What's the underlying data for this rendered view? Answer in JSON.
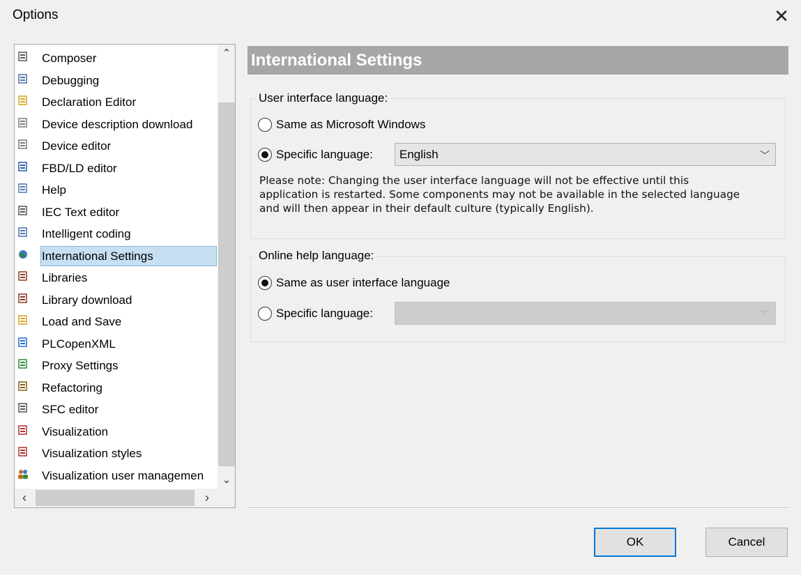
{
  "window": {
    "title": "Options",
    "close_icon": "close-icon"
  },
  "tree": {
    "items": [
      {
        "label": "Composer",
        "icon": "composer-icon",
        "color": "#5a5a5a"
      },
      {
        "label": "Debugging",
        "icon": "debugging-icon",
        "color": "#4a6fa5"
      },
      {
        "label": "Declaration Editor",
        "icon": "declaration-editor-icon",
        "color": "#d4a21a"
      },
      {
        "label": "Device description download",
        "icon": "device-download-icon",
        "color": "#7a7a7a"
      },
      {
        "label": "Device editor",
        "icon": "device-editor-icon",
        "color": "#7a7a7a"
      },
      {
        "label": "FBD/LD editor",
        "icon": "fbd-ld-icon",
        "color": "#2a58a8"
      },
      {
        "label": "Help",
        "icon": "help-book-icon",
        "color": "#4a7ab5"
      },
      {
        "label": "IEC Text editor",
        "icon": "iec-text-icon",
        "color": "#555555"
      },
      {
        "label": "Intelligent coding",
        "icon": "intelligent-coding-icon",
        "color": "#4a6fa5"
      },
      {
        "label": "International Settings",
        "icon": "globe-icon",
        "color": "#2f8a3a",
        "selected": true
      },
      {
        "label": "Libraries",
        "icon": "libraries-icon",
        "color": "#8a3a1a"
      },
      {
        "label": "Library download",
        "icon": "library-download-icon",
        "color": "#8a3a1a"
      },
      {
        "label": "Load and Save",
        "icon": "folder-icon",
        "color": "#d4a21a"
      },
      {
        "label": "PLCopenXML",
        "icon": "plcopenxml-icon",
        "color": "#1e6fd1"
      },
      {
        "label": "Proxy Settings",
        "icon": "proxy-icon",
        "color": "#2f8a3a"
      },
      {
        "label": "Refactoring",
        "icon": "refactoring-icon",
        "color": "#8a5a1a"
      },
      {
        "label": "SFC editor",
        "icon": "sfc-editor-icon",
        "color": "#555555"
      },
      {
        "label": "Visualization",
        "icon": "visualization-icon",
        "color": "#b03030"
      },
      {
        "label": "Visualization styles",
        "icon": "visualization-styles-icon",
        "color": "#b03030"
      },
      {
        "label": "Visualization user managemen",
        "icon": "users-icon",
        "color": "#c07020"
      }
    ]
  },
  "panel": {
    "header": "International Settings",
    "ui_language": {
      "legend": "User interface language:",
      "option_windows": "Same as Microsoft Windows",
      "option_specific": "Specific language:",
      "selected": "specific",
      "language_value": "English",
      "note": "Please note: Changing the user interface language will not be effective until this application is restarted. Some components may not be available in the selected language and will then appear in their default culture (typically English)."
    },
    "help_language": {
      "legend": "Online help language:",
      "option_same": "Same as user interface language",
      "option_specific": "Specific language:",
      "selected": "same",
      "language_value": ""
    }
  },
  "buttons": {
    "ok": "OK",
    "cancel": "Cancel"
  },
  "colors": {
    "accent": "#0078d7",
    "selection": "#c7dff2",
    "header_bg": "#a6a6a6"
  }
}
